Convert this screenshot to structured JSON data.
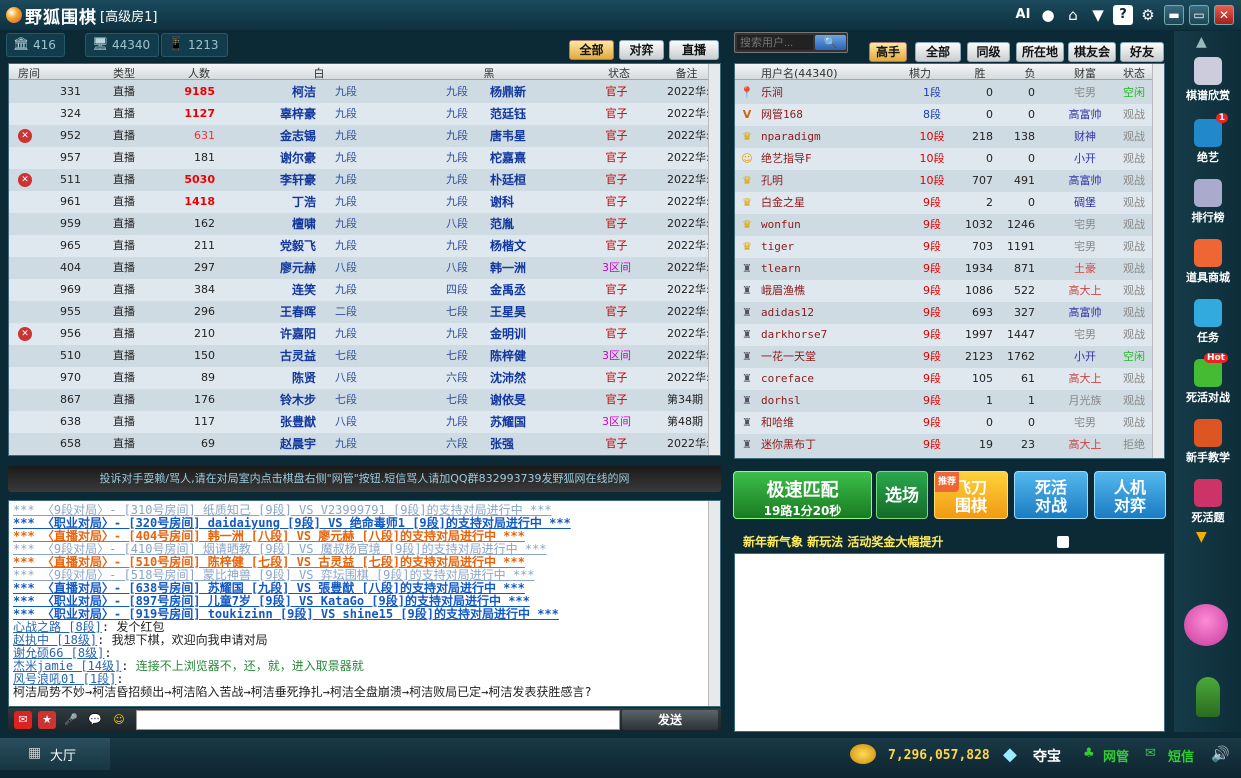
{
  "titlebar": {
    "logo": "野狐围棋",
    "room": "[高级房1]",
    "ai": "AI"
  },
  "stats": [
    {
      "icon": "bank-icon",
      "value": "416"
    },
    {
      "icon": "monitor-icon",
      "value": "44340"
    },
    {
      "icon": "phone-icon",
      "value": "1213"
    }
  ],
  "room_filters": [
    {
      "label": "全部",
      "active": true
    },
    {
      "label": "对弈",
      "active": false
    },
    {
      "label": "直播",
      "active": false
    }
  ],
  "room_table": {
    "headers": [
      "房间",
      "类型",
      "人数",
      "白",
      "黑",
      "状态",
      "备注"
    ],
    "rows": [
      {
        "icon": "",
        "room": "331",
        "type": "直播",
        "count": "9185",
        "count_style": "red",
        "white": "柯洁",
        "wr": "九段",
        "wf": "cn",
        "wcap": "8",
        "bcap": "92",
        "bf": "cn",
        "br": "九段",
        "bp": "",
        "black": "杨鼎新",
        "status": "官子",
        "note": "2022华:"
      },
      {
        "icon": "",
        "room": "324",
        "type": "直播",
        "count": "1127",
        "count_style": "red",
        "white": "辜梓豪",
        "wr": "九段",
        "wf": "cn",
        "wcap": "100",
        "bcap": "0",
        "bf": "cn",
        "br": "九段",
        "bp": "",
        "black": "范廷钰",
        "status": "官子",
        "note": "2022华:"
      },
      {
        "icon": "ban",
        "room": "952",
        "type": "直播",
        "count": "631",
        "count_style": "pink",
        "white": "金志锡",
        "wr": "九段",
        "wf": "kr",
        "wcap": "98",
        "bcap": "2",
        "bf": "cn",
        "br": "九段",
        "bp": "y",
        "black": "唐韦星",
        "status": "官子",
        "note": "2022华:"
      },
      {
        "icon": "",
        "room": "957",
        "type": "直播",
        "count": "181",
        "count_style": "",
        "white": "谢尔豪",
        "wr": "九段",
        "wf": "cn",
        "wcap": "7",
        "bcap": "93",
        "bf": "cn",
        "br": "九段",
        "bp": "",
        "black": "柁嘉熹",
        "status": "官子",
        "note": "2022华:"
      },
      {
        "icon": "ban",
        "room": "511",
        "type": "直播",
        "count": "5030",
        "count_style": "red",
        "white": "李轩豪",
        "wr": "九段",
        "wf": "cn",
        "wcap": "99",
        "bcap": "1",
        "bf": "kr",
        "br": "九段",
        "bp": "y",
        "black": "朴廷桓",
        "status": "官子",
        "note": "2022华:"
      },
      {
        "icon": "",
        "room": "961",
        "type": "直播",
        "count": "1418",
        "count_style": "red",
        "white": "丁浩",
        "wr": "九段",
        "wf": "cn",
        "wcap": "100",
        "bcap": "0",
        "bf": "cn",
        "br": "九段",
        "bp": "",
        "black": "谢科",
        "status": "官子",
        "note": "2022华:"
      },
      {
        "icon": "",
        "room": "959",
        "type": "直播",
        "count": "162",
        "count_style": "",
        "white": "檀啸",
        "wr": "九段",
        "wf": "cn",
        "wcap": "98",
        "bcap": "2",
        "bf": "cn",
        "br": "八段",
        "bp": "",
        "black": "范胤",
        "status": "官子",
        "note": "2022华:"
      },
      {
        "icon": "",
        "room": "965",
        "type": "直播",
        "count": "211",
        "count_style": "",
        "white": "党毅飞",
        "wr": "九段",
        "wf": "cn",
        "wcap": "100",
        "bcap": "0",
        "bf": "cn",
        "br": "九段",
        "bp": "y",
        "black": "杨楷文",
        "status": "官子",
        "note": "2022华:"
      },
      {
        "icon": "",
        "room": "404",
        "type": "直播",
        "count": "297",
        "count_style": "",
        "white": "廖元赫",
        "wr": "八段",
        "wf": "cn",
        "wcap": "1",
        "bcap": "99",
        "bf": "cn",
        "br": "八段",
        "bp": "",
        "black": "韩一洲",
        "status": "3区间",
        "note": "2022华:"
      },
      {
        "icon": "",
        "room": "969",
        "type": "直播",
        "count": "384",
        "count_style": "",
        "white": "连笑",
        "wr": "九段",
        "wf": "cn",
        "wcap": "85",
        "bcap": "15",
        "bf": "kr",
        "br": "四段",
        "bp": "y",
        "black": "金禹丞",
        "status": "官子",
        "note": "2022华:"
      },
      {
        "icon": "",
        "room": "955",
        "type": "直播",
        "count": "296",
        "count_style": "",
        "white": "王春晖",
        "wr": "二段",
        "wf": "cn",
        "wcap": "0",
        "bcap": "100",
        "bf": "cn",
        "br": "七段",
        "bp": "",
        "black": "王星昊",
        "status": "官子",
        "note": "2022华:"
      },
      {
        "icon": "ban",
        "room": "956",
        "type": "直播",
        "count": "210",
        "count_style": "",
        "white": "许嘉阳",
        "wr": "九段",
        "wf": "cn",
        "wcap": "1",
        "bcap": "99",
        "bf": "kr",
        "br": "九段",
        "bp": "y",
        "black": "金明训",
        "status": "官子",
        "note": "2022华:"
      },
      {
        "icon": "",
        "room": "510",
        "type": "直播",
        "count": "150",
        "count_style": "",
        "white": "古灵益",
        "wr": "七段",
        "wf": "cn",
        "wcap": "93",
        "bcap": "7",
        "bf": "cn",
        "br": "七段",
        "bp": "",
        "black": "陈梓健",
        "status": "3区间",
        "note": "2022华:"
      },
      {
        "icon": "",
        "room": "970",
        "type": "直播",
        "count": "89",
        "count_style": "",
        "white": "陈贤",
        "wr": "八段",
        "wf": "cn",
        "wcap": "32",
        "bcap": "68",
        "bf": "cn",
        "br": "六段",
        "bp": "y",
        "black": "沈沛然",
        "status": "官子",
        "note": "2022华:"
      },
      {
        "icon": "",
        "room": "867",
        "type": "直播",
        "count": "176",
        "count_style": "",
        "white": "铃木步",
        "wr": "七段",
        "wf": "jp",
        "wcap": "100",
        "bcap": "0",
        "bf": "jp",
        "br": "七段",
        "bp": "",
        "black": "谢依旻",
        "status": "官子",
        "note": "第34期"
      },
      {
        "icon": "",
        "room": "638",
        "type": "直播",
        "count": "117",
        "count_style": "",
        "white": "张豊猷",
        "wr": "八段",
        "wf": "jp",
        "wcap": "5",
        "bcap": "95",
        "bf": "cn",
        "br": "九段",
        "bp": "y",
        "black": "苏耀国",
        "status": "3区间",
        "note": "第48期"
      },
      {
        "icon": "",
        "room": "658",
        "type": "直播",
        "count": "69",
        "count_style": "",
        "white": "赵晨宇",
        "wr": "九段",
        "wf": "cn",
        "wcap": "98",
        "bcap": "2",
        "bf": "cn",
        "br": "六段",
        "bp": "y",
        "black": "张强",
        "status": "官子",
        "note": "2022华:"
      }
    ]
  },
  "complaint": "投诉对手耍赖/骂人,请在对局室内点击棋盘右侧\"网管\"按钮.短信骂人请加QQ群832993739发野狐网在线的网",
  "chat": [
    {
      "text": "*** 〈9段对局〉- [310号房间] 纸质知己 [9段] VS V23999791 [9段]的支持对局进行中 ***",
      "style": "gray"
    },
    {
      "text": "*** 〈职业对局〉- [320号房间] daidaiyung [9段] VS 绝命毒师1 [9段]的支持对局进行中 ***",
      "style": "blue"
    },
    {
      "text": "*** 〈直播对局〉- [404号房间] 韩一洲 [八段] VS 廖元赫 [八段]的支持对局进行中 ***",
      "style": "orange"
    },
    {
      "text": "*** 〈9段对局〉- [410号房间] 烟请晒教 [9段] VS 魔叔杨官境 [9段]的支持对局进行中 ***",
      "style": "gray"
    },
    {
      "text": "*** 〈直播对局〉- [510号房间] 陈梓健 [七段] VS 古灵益 [七段]的支持对局进行中 ***",
      "style": "orange"
    },
    {
      "text": "*** 〈9段对局〉- [518号房间] 蒙比神兽 [9段] VS 弈坛围棋 [9段]的支持对局进行中 ***",
      "style": "gray"
    },
    {
      "text": "*** 〈直播对局〉- [638号房间] 苏耀国 [九段] VS 張豊猷 [八段]的支持对局进行中 ***",
      "style": "blue"
    },
    {
      "text": "*** 〈职业对局〉- [897号房间] 儿童7岁 [9段] VS KataGo [9段]的支持对局进行中 ***",
      "style": "blue"
    },
    {
      "text": "*** 〈职业对局〉- [919号房间] toukizinn [9段] VS shine15 [9段]的支持对局进行中 ***",
      "style": "blue"
    },
    {
      "user": "心战之路 [8段]",
      "msg": " 发个红包",
      "msgstyle": "black"
    },
    {
      "user": "赵执中 [18级]",
      "msg": " 我想下棋，欢迎向我申请对局",
      "msgstyle": "black"
    },
    {
      "user": "谢允硕66 [8级]",
      "msg": "",
      "msgstyle": "black"
    },
    {
      "user": "杰米jamie [14级]",
      "msg": " 连接不上浏览器不，还，就，进入取景器就",
      "msgstyle": "green"
    },
    {
      "user": "风号浪吼01 [1段]",
      "msg": "",
      "msgstyle": "black"
    },
    {
      "text": "柯洁局势不妙→柯洁昏招频出→柯洁陷入苦战→柯洁垂死挣扎→柯洁全盘崩溃→柯洁败局已定→柯洁发表获胜感言?",
      "style": "black"
    }
  ],
  "chat_send": "发送",
  "search": {
    "placeholder": "搜索用户...",
    "button": "🔍"
  },
  "user_filters": [
    {
      "label": "高手",
      "active": true
    },
    {
      "label": "全部",
      "active": false
    },
    {
      "label": "同级",
      "active": false
    },
    {
      "label": "所在地",
      "active": false
    },
    {
      "label": "棋友会",
      "active": false
    },
    {
      "label": "好友",
      "active": false
    }
  ],
  "user_table": {
    "headers": [
      "用户名(44340)",
      "棋力",
      "胜",
      "负",
      "财富",
      "状态"
    ],
    "rows": [
      {
        "icon": "pin",
        "name": "乐涧",
        "flag": "cn",
        "rank": "1段",
        "rk": "blu",
        "win": "0",
        "loss": "0",
        "wealth": "宅男",
        "ws": "",
        "status": "空闲",
        "ss": "kx"
      },
      {
        "icon": "vip",
        "name": "网管168",
        "flag": "cn",
        "rank": "8段",
        "rk": "blu",
        "win": "0",
        "loss": "0",
        "wealth": "高富帅",
        "ws": "blu",
        "status": "观战",
        "ss": "gz"
      },
      {
        "icon": "crown",
        "name": "nparadigm",
        "flag": "cn",
        "rank": "10段",
        "rk": "red",
        "win": "218",
        "loss": "138",
        "wealth": "财神",
        "ws": "blu",
        "status": "观战",
        "ss": "gz"
      },
      {
        "icon": "face",
        "name": "绝艺指导F",
        "flag": "cn",
        "rank": "10段",
        "rk": "red",
        "win": "0",
        "loss": "0",
        "wealth": "小开",
        "ws": "blu",
        "status": "观战",
        "ss": "gz"
      },
      {
        "icon": "crown",
        "name": "孔明",
        "flag": "team",
        "rank": "10段",
        "rk": "red",
        "win": "707",
        "loss": "491",
        "wealth": "高富帅",
        "ws": "blu",
        "status": "观战",
        "ss": "gz"
      },
      {
        "icon": "crown",
        "name": "白金之星",
        "flag": "kr",
        "rank": "9段",
        "rk": "red",
        "win": "2",
        "loss": "0",
        "wealth": "碉堡",
        "ws": "blu",
        "status": "观战",
        "ss": "gz"
      },
      {
        "icon": "crown",
        "name": "wonfun",
        "flag": "kr",
        "rank": "9段",
        "rk": "red",
        "win": "1032",
        "loss": "1246",
        "wealth": "宅男",
        "ws": "",
        "status": "观战",
        "ss": "gz"
      },
      {
        "icon": "crown",
        "name": "tiger",
        "flag": "jp",
        "rank": "9段",
        "rk": "red",
        "win": "703",
        "loss": "1191",
        "wealth": "宅男",
        "ws": "",
        "status": "观战",
        "ss": "gz"
      },
      {
        "icon": "chess",
        "name": "tlearn",
        "flag": "jp",
        "rank": "9段",
        "rk": "red",
        "win": "1934",
        "loss": "871",
        "wealth": "土豪",
        "ws": "rich",
        "status": "观战",
        "ss": "gz"
      },
      {
        "icon": "chess",
        "name": "峨眉渔樵",
        "flag": "cn",
        "rank": "9段",
        "rk": "red",
        "win": "1086",
        "loss": "522",
        "wealth": "高大上",
        "ws": "rich",
        "status": "观战",
        "ss": "gz"
      },
      {
        "icon": "chess",
        "name": "adidas12",
        "flag": "kr",
        "rank": "9段",
        "rk": "red",
        "win": "693",
        "loss": "327",
        "wealth": "高富帅",
        "ws": "blu",
        "status": "观战",
        "ss": "gz"
      },
      {
        "icon": "chess",
        "name": "darkhorse7",
        "flag": "jp",
        "rank": "9段",
        "rk": "red",
        "win": "1997",
        "loss": "1447",
        "wealth": "宅男",
        "ws": "",
        "status": "观战",
        "ss": "gz"
      },
      {
        "icon": "chess",
        "name": "一花一天堂",
        "flag": "team",
        "rank": "9段",
        "rk": "red",
        "win": "2123",
        "loss": "1762",
        "wealth": "小开",
        "ws": "blu",
        "status": "空闲",
        "ss": "kx"
      },
      {
        "icon": "chess",
        "name": "coreface",
        "flag": "kr",
        "rank": "9段",
        "rk": "red",
        "win": "105",
        "loss": "61",
        "wealth": "高大上",
        "ws": "rich",
        "status": "观战",
        "ss": "gz"
      },
      {
        "icon": "chess",
        "name": "dorhsl",
        "flag": "jp",
        "rank": "9段",
        "rk": "red",
        "win": "1",
        "loss": "1",
        "wealth": "月光族",
        "ws": "",
        "status": "观战",
        "ss": "gz"
      },
      {
        "icon": "chess",
        "name": "和哈维",
        "flag": "cn",
        "rank": "9段",
        "rk": "red",
        "win": "0",
        "loss": "0",
        "wealth": "宅男",
        "ws": "",
        "status": "观战",
        "ss": "gz"
      },
      {
        "icon": "chess",
        "name": "迷你黑布丁",
        "flag": "team",
        "rank": "9段",
        "rk": "red",
        "win": "19",
        "loss": "23",
        "wealth": "高大上",
        "ws": "rich",
        "status": "拒绝",
        "ss": "jz"
      }
    ]
  },
  "buttons": {
    "quick_match": "极速匹配",
    "quick_sub": "19路1分20秒",
    "choose": "选场",
    "flying": "飞刀围棋",
    "flying_tag": "推荐",
    "tsumego": "死活对战",
    "ai_play": "人机对弈"
  },
  "activity": "新年新气象 新玩法 活动奖金大幅提升",
  "sidebar": [
    {
      "label": "棋谱欣赏",
      "icon": "book-icon"
    },
    {
      "label": "绝艺",
      "icon": "ai-icon",
      "badge": "1"
    },
    {
      "label": "排行榜",
      "icon": "list-icon"
    },
    {
      "label": "道具商城",
      "icon": "gem-icon"
    },
    {
      "label": "任务",
      "icon": "task-icon"
    },
    {
      "label": "死活对战",
      "icon": "sword-icon",
      "badge": "Hot"
    },
    {
      "label": "新手教学",
      "icon": "teach-icon"
    },
    {
      "label": "死活题",
      "icon": "puzzle-icon"
    }
  ],
  "bottom": {
    "hall": "大厅",
    "money": "7,296,057,828",
    "treasure": "夺宝",
    "admin": "网管",
    "sms": "短信"
  }
}
